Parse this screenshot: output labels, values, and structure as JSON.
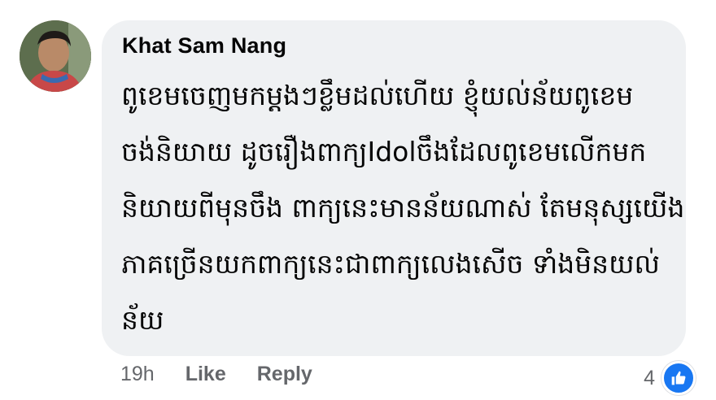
{
  "comment": {
    "author": "Khat Sam Nang",
    "text_lines": [
      "ពូខេមចេញមកម្ដងៗខ្លឹមដល់ហើយ ខ្ញុំយល់ន័យពូខេម",
      "ចង់និយាយ ដូចរឿងពាក្យIdolចឹងដែលពូខេមលើកមក",
      "និយាយពីមុនចឹង ពាក្យនេះមានន័យណាស់ តែមនុស្សយើង",
      "ភាគច្រើនយកពាក្យនេះជាពាក្យលេងសើច ទាំងមិនយល់",
      "ន័យ"
    ]
  },
  "footer": {
    "time": "19h",
    "like_label": "Like",
    "reply_label": "Reply"
  },
  "reactions": {
    "count": "4",
    "icon": "thumbs-up-icon",
    "color": "#1877f2"
  }
}
